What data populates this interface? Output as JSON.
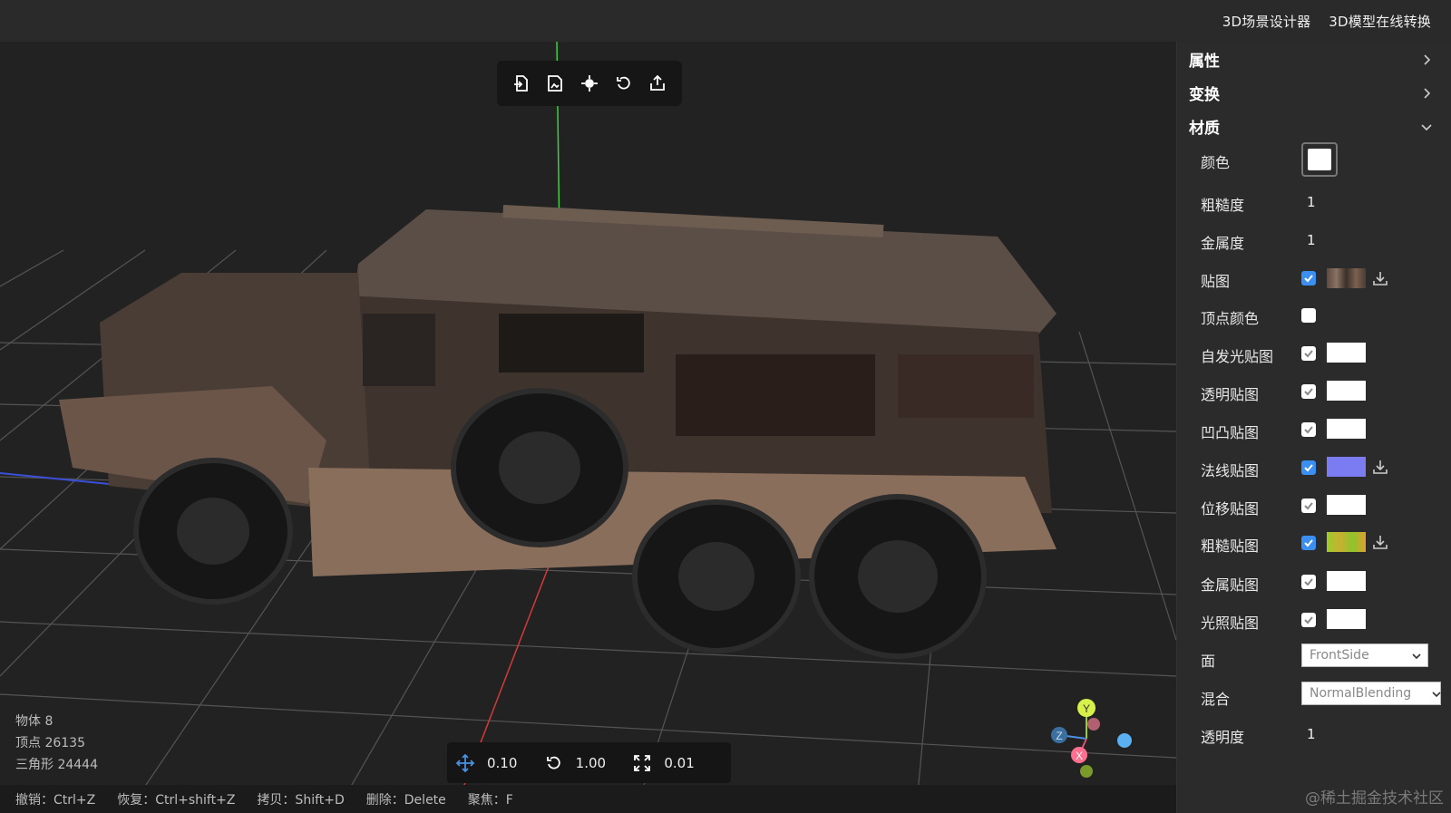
{
  "topbar": {
    "link1": "3D场景设计器",
    "link2": "3D模型在线转换"
  },
  "toolbar": {
    "icons": [
      "import-icon",
      "image-import-icon",
      "focus-center-icon",
      "reset-rotate-icon",
      "export-icon"
    ]
  },
  "stats": {
    "objects": "物体 8",
    "vertices": "顶点 26135",
    "triangles": "三角形 24444"
  },
  "stepbar": {
    "translate": "0.10",
    "rotate": "1.00",
    "scale": "0.01"
  },
  "shortcuts": [
    "撤销：Ctrl+Z",
    "恢复：Ctrl+shift+Z",
    "拷贝：Shift+D",
    "删除：Delete",
    "聚焦：F"
  ],
  "gizmo": {
    "y": "Y",
    "z": "Z",
    "x": "X"
  },
  "panel": {
    "sections": {
      "attributes": "属性",
      "transform": "变换",
      "material": "材质"
    },
    "material": {
      "color_label": "颜色",
      "roughness_label": "粗糙度",
      "roughness_value": "1",
      "metalness_label": "金属度",
      "metalness_value": "1",
      "map_label": "贴图",
      "vertex_color_label": "顶点颜色",
      "emissive_map_label": "自发光贴图",
      "alpha_map_label": "透明贴图",
      "bump_map_label": "凹凸贴图",
      "normal_map_label": "法线贴图",
      "displacement_map_label": "位移贴图",
      "roughness_map_label": "粗糙贴图",
      "metalness_map_label": "金属贴图",
      "light_map_label": "光照贴图",
      "side_label": "面",
      "side_value": "FrontSide",
      "blending_label": "混合",
      "blending_value": "NormalBlending",
      "opacity_label": "透明度",
      "opacity_value": "1"
    },
    "colors": {
      "accent": "#3b8ff0",
      "normal_map": "#7b7cf2",
      "roughness_map": "#9ccc2c"
    }
  },
  "watermark": "@稀土掘金技术社区"
}
